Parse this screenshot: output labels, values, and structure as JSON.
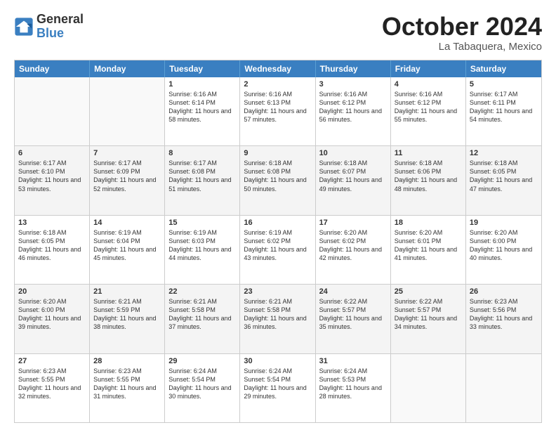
{
  "header": {
    "logo_general": "General",
    "logo_blue": "Blue",
    "month_title": "October 2024",
    "location": "La Tabaquera, Mexico"
  },
  "days_of_week": [
    "Sunday",
    "Monday",
    "Tuesday",
    "Wednesday",
    "Thursday",
    "Friday",
    "Saturday"
  ],
  "weeks": [
    [
      {
        "day": "",
        "empty": true
      },
      {
        "day": "",
        "empty": true
      },
      {
        "day": "1",
        "sunrise": "Sunrise: 6:16 AM",
        "sunset": "Sunset: 6:14 PM",
        "daylight": "Daylight: 11 hours and 58 minutes."
      },
      {
        "day": "2",
        "sunrise": "Sunrise: 6:16 AM",
        "sunset": "Sunset: 6:13 PM",
        "daylight": "Daylight: 11 hours and 57 minutes."
      },
      {
        "day": "3",
        "sunrise": "Sunrise: 6:16 AM",
        "sunset": "Sunset: 6:12 PM",
        "daylight": "Daylight: 11 hours and 56 minutes."
      },
      {
        "day": "4",
        "sunrise": "Sunrise: 6:16 AM",
        "sunset": "Sunset: 6:12 PM",
        "daylight": "Daylight: 11 hours and 55 minutes."
      },
      {
        "day": "5",
        "sunrise": "Sunrise: 6:17 AM",
        "sunset": "Sunset: 6:11 PM",
        "daylight": "Daylight: 11 hours and 54 minutes."
      }
    ],
    [
      {
        "day": "6",
        "sunrise": "Sunrise: 6:17 AM",
        "sunset": "Sunset: 6:10 PM",
        "daylight": "Daylight: 11 hours and 53 minutes."
      },
      {
        "day": "7",
        "sunrise": "Sunrise: 6:17 AM",
        "sunset": "Sunset: 6:09 PM",
        "daylight": "Daylight: 11 hours and 52 minutes."
      },
      {
        "day": "8",
        "sunrise": "Sunrise: 6:17 AM",
        "sunset": "Sunset: 6:08 PM",
        "daylight": "Daylight: 11 hours and 51 minutes."
      },
      {
        "day": "9",
        "sunrise": "Sunrise: 6:18 AM",
        "sunset": "Sunset: 6:08 PM",
        "daylight": "Daylight: 11 hours and 50 minutes."
      },
      {
        "day": "10",
        "sunrise": "Sunrise: 6:18 AM",
        "sunset": "Sunset: 6:07 PM",
        "daylight": "Daylight: 11 hours and 49 minutes."
      },
      {
        "day": "11",
        "sunrise": "Sunrise: 6:18 AM",
        "sunset": "Sunset: 6:06 PM",
        "daylight": "Daylight: 11 hours and 48 minutes."
      },
      {
        "day": "12",
        "sunrise": "Sunrise: 6:18 AM",
        "sunset": "Sunset: 6:05 PM",
        "daylight": "Daylight: 11 hours and 47 minutes."
      }
    ],
    [
      {
        "day": "13",
        "sunrise": "Sunrise: 6:18 AM",
        "sunset": "Sunset: 6:05 PM",
        "daylight": "Daylight: 11 hours and 46 minutes."
      },
      {
        "day": "14",
        "sunrise": "Sunrise: 6:19 AM",
        "sunset": "Sunset: 6:04 PM",
        "daylight": "Daylight: 11 hours and 45 minutes."
      },
      {
        "day": "15",
        "sunrise": "Sunrise: 6:19 AM",
        "sunset": "Sunset: 6:03 PM",
        "daylight": "Daylight: 11 hours and 44 minutes."
      },
      {
        "day": "16",
        "sunrise": "Sunrise: 6:19 AM",
        "sunset": "Sunset: 6:02 PM",
        "daylight": "Daylight: 11 hours and 43 minutes."
      },
      {
        "day": "17",
        "sunrise": "Sunrise: 6:20 AM",
        "sunset": "Sunset: 6:02 PM",
        "daylight": "Daylight: 11 hours and 42 minutes."
      },
      {
        "day": "18",
        "sunrise": "Sunrise: 6:20 AM",
        "sunset": "Sunset: 6:01 PM",
        "daylight": "Daylight: 11 hours and 41 minutes."
      },
      {
        "day": "19",
        "sunrise": "Sunrise: 6:20 AM",
        "sunset": "Sunset: 6:00 PM",
        "daylight": "Daylight: 11 hours and 40 minutes."
      }
    ],
    [
      {
        "day": "20",
        "sunrise": "Sunrise: 6:20 AM",
        "sunset": "Sunset: 6:00 PM",
        "daylight": "Daylight: 11 hours and 39 minutes."
      },
      {
        "day": "21",
        "sunrise": "Sunrise: 6:21 AM",
        "sunset": "Sunset: 5:59 PM",
        "daylight": "Daylight: 11 hours and 38 minutes."
      },
      {
        "day": "22",
        "sunrise": "Sunrise: 6:21 AM",
        "sunset": "Sunset: 5:58 PM",
        "daylight": "Daylight: 11 hours and 37 minutes."
      },
      {
        "day": "23",
        "sunrise": "Sunrise: 6:21 AM",
        "sunset": "Sunset: 5:58 PM",
        "daylight": "Daylight: 11 hours and 36 minutes."
      },
      {
        "day": "24",
        "sunrise": "Sunrise: 6:22 AM",
        "sunset": "Sunset: 5:57 PM",
        "daylight": "Daylight: 11 hours and 35 minutes."
      },
      {
        "day": "25",
        "sunrise": "Sunrise: 6:22 AM",
        "sunset": "Sunset: 5:57 PM",
        "daylight": "Daylight: 11 hours and 34 minutes."
      },
      {
        "day": "26",
        "sunrise": "Sunrise: 6:23 AM",
        "sunset": "Sunset: 5:56 PM",
        "daylight": "Daylight: 11 hours and 33 minutes."
      }
    ],
    [
      {
        "day": "27",
        "sunrise": "Sunrise: 6:23 AM",
        "sunset": "Sunset: 5:55 PM",
        "daylight": "Daylight: 11 hours and 32 minutes."
      },
      {
        "day": "28",
        "sunrise": "Sunrise: 6:23 AM",
        "sunset": "Sunset: 5:55 PM",
        "daylight": "Daylight: 11 hours and 31 minutes."
      },
      {
        "day": "29",
        "sunrise": "Sunrise: 6:24 AM",
        "sunset": "Sunset: 5:54 PM",
        "daylight": "Daylight: 11 hours and 30 minutes."
      },
      {
        "day": "30",
        "sunrise": "Sunrise: 6:24 AM",
        "sunset": "Sunset: 5:54 PM",
        "daylight": "Daylight: 11 hours and 29 minutes."
      },
      {
        "day": "31",
        "sunrise": "Sunrise: 6:24 AM",
        "sunset": "Sunset: 5:53 PM",
        "daylight": "Daylight: 11 hours and 28 minutes."
      },
      {
        "day": "",
        "empty": true
      },
      {
        "day": "",
        "empty": true
      }
    ]
  ]
}
